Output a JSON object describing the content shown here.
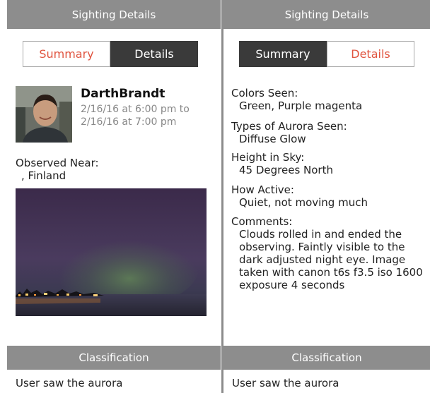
{
  "left": {
    "header": "Sighting Details",
    "tabs": {
      "summary": "Summary",
      "details": "Details"
    },
    "user": {
      "name": "DarthBrandt",
      "time_start": "2/16/16 at 6:00 pm to",
      "time_end": "2/16/16 at 7:00 pm"
    },
    "observed_label": "Observed Near:",
    "observed_value": ", Finland",
    "classification_header": "Classification",
    "classification_text": "User saw the aurora"
  },
  "right": {
    "header": "Sighting Details",
    "tabs": {
      "summary": "Summary",
      "details": "Details"
    },
    "fields": [
      {
        "label": "Colors Seen:",
        "value": "Green, Purple magenta"
      },
      {
        "label": "Types of Aurora Seen:",
        "value": "Diffuse Glow"
      },
      {
        "label": "Height in Sky:",
        "value": "45 Degrees North"
      },
      {
        "label": "How Active:",
        "value": "Quiet, not moving much"
      },
      {
        "label": "Comments:",
        "value": "Clouds rolled in and ended the observing. Faintly visible to the dark adjusted night eye. Image taken with canon t6s f3.5 iso 1600 exposure 4 seconds"
      }
    ],
    "classification_header": "Classification",
    "classification_text": "User saw the aurora"
  },
  "colors": {
    "header_gray": "#8d8d8d",
    "accent_red": "#e0543f",
    "dark_tab": "#3a3a3a"
  }
}
